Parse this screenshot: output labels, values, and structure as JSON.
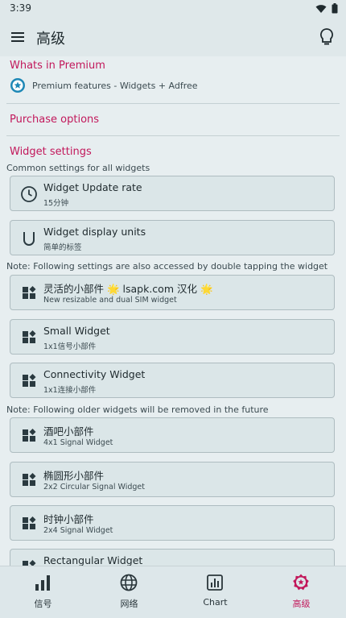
{
  "status": {
    "time": "3:39"
  },
  "appbar": {
    "title": "高级"
  },
  "premium": {
    "section_title": "Whats in Premium",
    "feature_text": "Premium features - Widgets + Adfree"
  },
  "purchase": {
    "title": "Purchase options"
  },
  "widget_settings": {
    "title": "Widget settings",
    "common_note": "Common settings for all widgets",
    "update_rate": {
      "title": "Widget Update rate",
      "value": "15分钟"
    },
    "display_units": {
      "title": "Widget display units",
      "value": "简单的标签"
    },
    "double_tap_note": "Note: Following settings are also accessed by double tapping the widget",
    "flexible": {
      "title": "灵活的小部件 🌟 lsapk.com 汉化 🌟",
      "subtitle": "New resizable and dual SIM widget"
    },
    "small": {
      "title": "Small Widget",
      "subtitle": "1x1信号小部件"
    },
    "connectivity": {
      "title": "Connectivity Widget",
      "subtitle": "1x1连接小部件"
    },
    "older_note": "Note: Following older widgets will be removed in the future",
    "bar": {
      "title": "酒吧小部件",
      "subtitle": "4x1 Signal Widget"
    },
    "ellipse": {
      "title": "椭圆形小部件",
      "subtitle": "2x2 Circular Signal Widget"
    },
    "clock": {
      "title": "时钟小部件",
      "subtitle": "2x4 Signal Widget"
    },
    "rect": {
      "title": "Rectangular Widget"
    }
  },
  "nav": {
    "signal": "信号",
    "network": "网络",
    "chart": "Chart",
    "advanced": "高级"
  },
  "colors": {
    "accent": "#c2185b",
    "background": "#e7eef0",
    "card": "#dbe6e8"
  }
}
